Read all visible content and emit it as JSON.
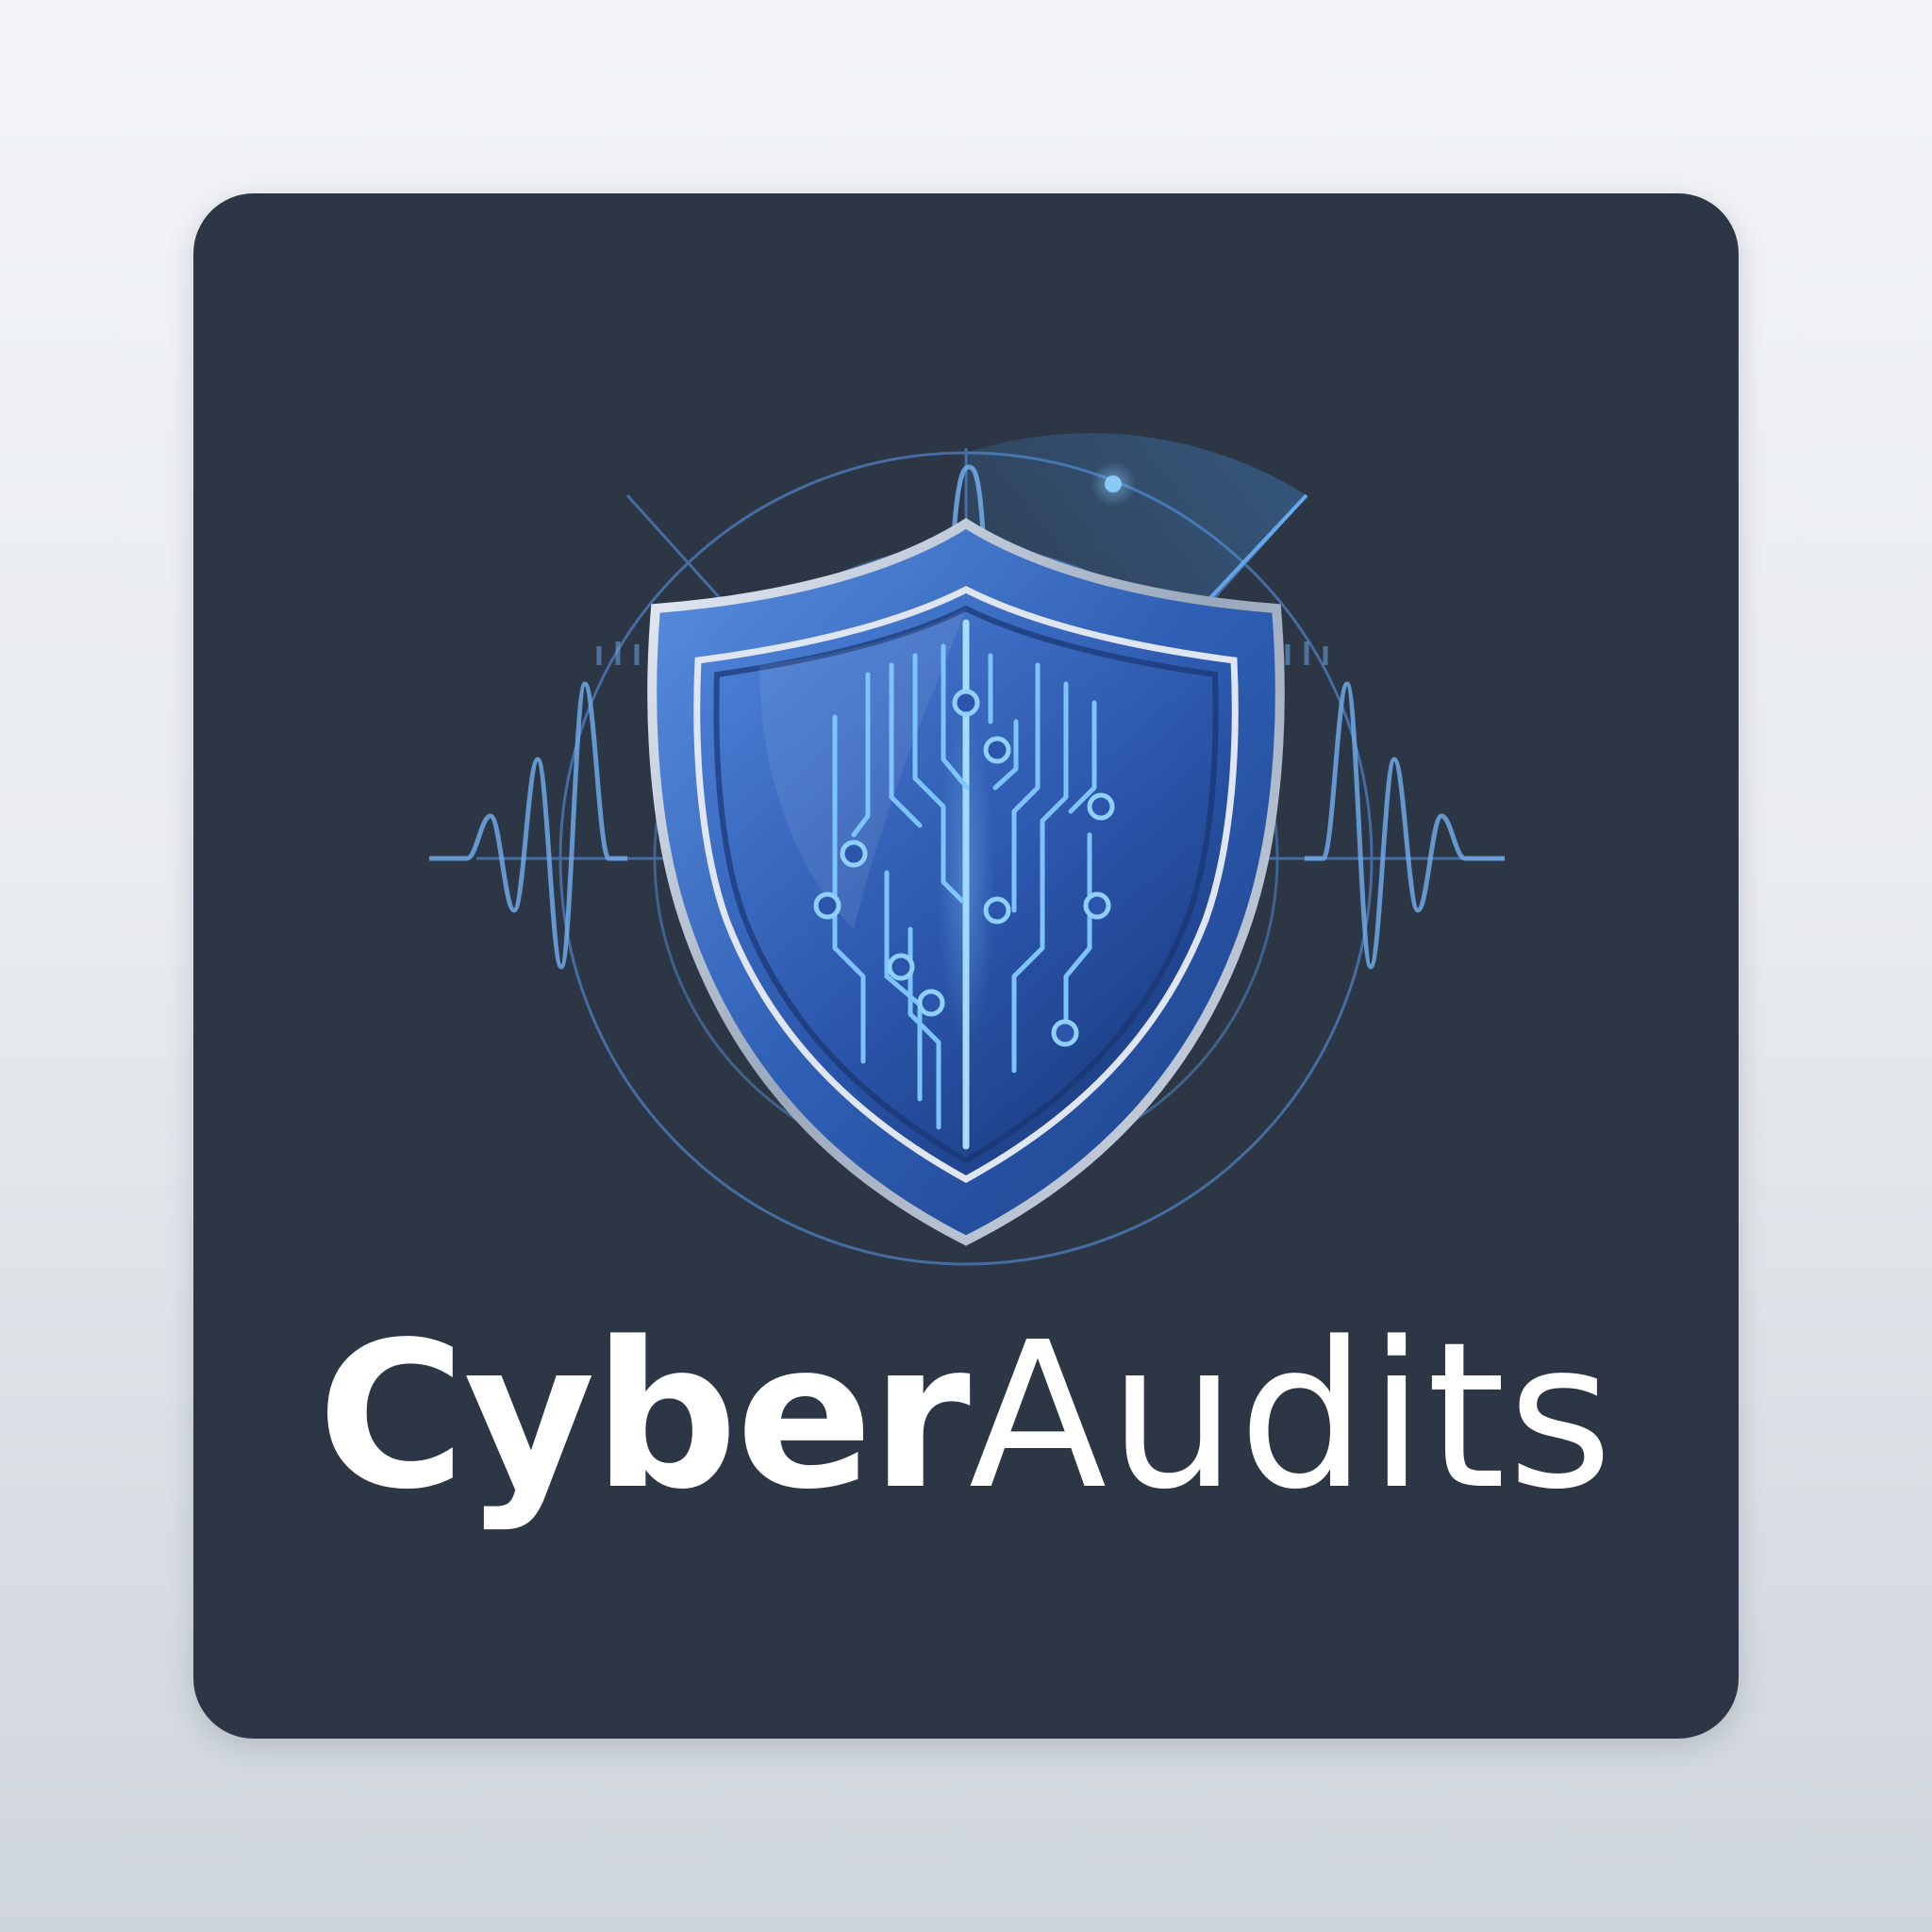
{
  "logo": {
    "name_part_1": "Cyber",
    "name_part_2": "Audits",
    "icon": "shield-circuit-icon",
    "colors": {
      "background": "#e9ecf0",
      "card": "#2c3644",
      "shield_blue": "#2f5fb5",
      "trace_blue": "#7cc3ff",
      "text": "#ffffff"
    }
  }
}
